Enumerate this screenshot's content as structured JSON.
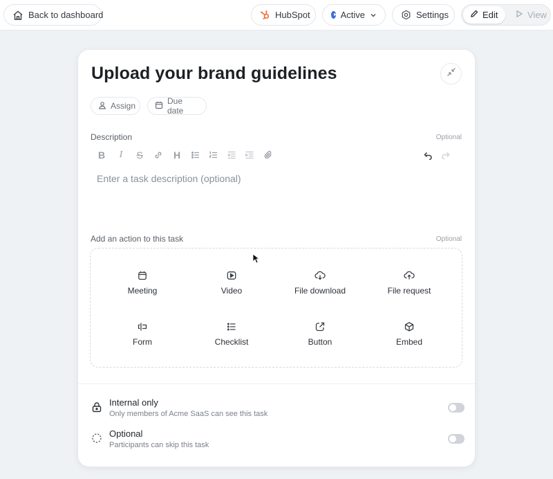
{
  "topbar": {
    "back_label": "Back to dashboard",
    "hubspot_label": "HubSpot",
    "status_label": "Active",
    "settings_label": "Settings",
    "edit_label": "Edit",
    "view_label": "View"
  },
  "task": {
    "title": "Upload your brand guidelines",
    "assign_label": "Assign",
    "due_date_label": "Due date",
    "description_label": "Description",
    "description_optional": "Optional",
    "description_placeholder": "Enter a task description (optional)",
    "action_label": "Add an action to this task",
    "action_optional": "Optional"
  },
  "actions": [
    {
      "label": "Meeting",
      "icon": "calendar-icon"
    },
    {
      "label": "Video",
      "icon": "video-icon"
    },
    {
      "label": "File download",
      "icon": "cloud-download-icon"
    },
    {
      "label": "File request",
      "icon": "cloud-upload-icon"
    },
    {
      "label": "Form",
      "icon": "form-icon"
    },
    {
      "label": "Checklist",
      "icon": "checklist-icon"
    },
    {
      "label": "Button",
      "icon": "external-link-icon"
    },
    {
      "label": "Embed",
      "icon": "cube-icon"
    }
  ],
  "settings_rows": [
    {
      "title": "Internal only",
      "subtitle": "Only members of Acme SaaS can see this task",
      "icon": "lock-icon",
      "enabled": false
    },
    {
      "title": "Optional",
      "subtitle": "Participants can skip this task",
      "icon": "dashed-circle-icon",
      "enabled": false
    }
  ],
  "colors": {
    "status_accent": "#3d6fd8",
    "hubspot_accent": "#f26a3c"
  }
}
